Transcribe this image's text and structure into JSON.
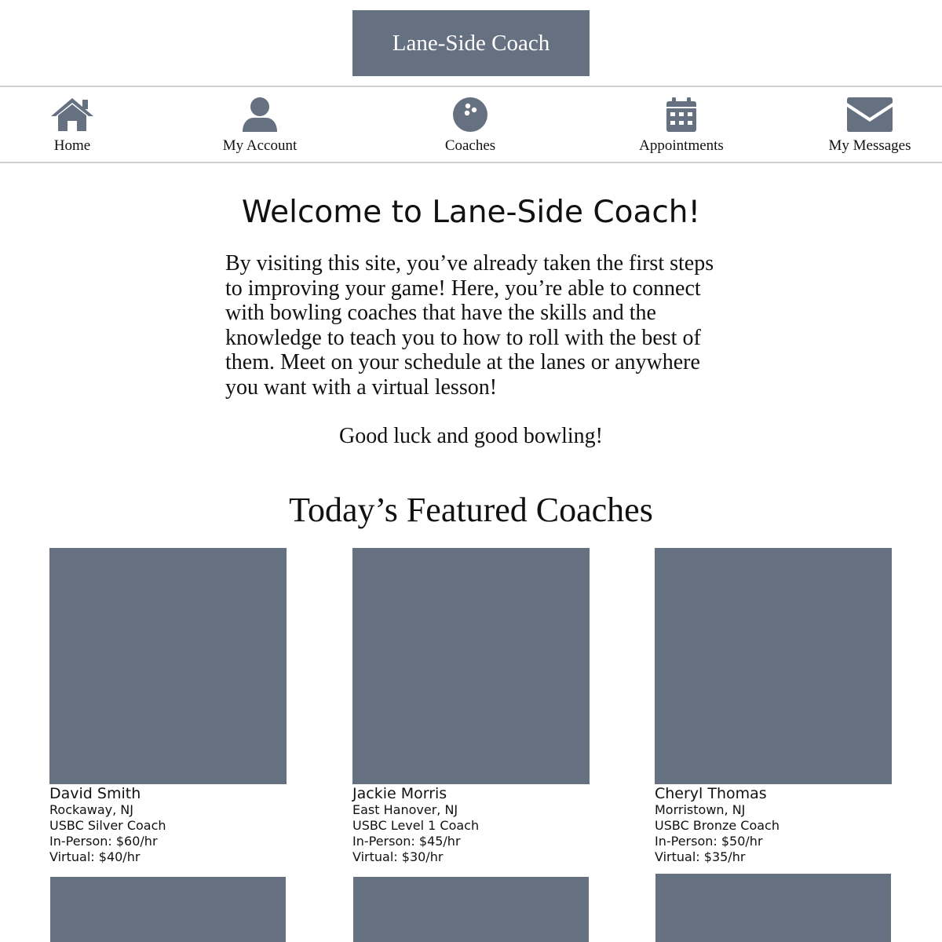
{
  "brand": {
    "name": "Lane-Side Coach",
    "accent_color": "#657081"
  },
  "nav": {
    "items": [
      {
        "label": "Home",
        "icon": "home-icon"
      },
      {
        "label": "My Account",
        "icon": "user-icon"
      },
      {
        "label": "Coaches",
        "icon": "bowling-ball-icon"
      },
      {
        "label": "Appointments",
        "icon": "calendar-icon"
      },
      {
        "label": "My Messages",
        "icon": "envelope-icon"
      }
    ]
  },
  "main": {
    "heading": "Welcome to Lane-Side Coach!",
    "intro": "By visiting this site, you’ve already taken the first steps to improving your game! Here, you’re able to connect with bowling coaches that have the skills and the knowledge to teach you to how to roll with the best of them. Meet on your schedule at the lanes or anywhere you want with a virtual lesson!",
    "closing": "Good luck and good bowling!",
    "featured_heading": "Today’s Featured Coaches"
  },
  "coaches": [
    {
      "name": "David Smith",
      "location": "Rockaway, NJ",
      "certification": "USBC Silver Coach",
      "in_person": "In-Person: $60/hr",
      "virtual": "Virtual: $40/hr"
    },
    {
      "name": "Jackie Morris",
      "location": "East Hanover, NJ",
      "certification": "USBC Level 1 Coach",
      "in_person": "In-Person: $45/hr",
      "virtual": "Virtual: $30/hr"
    },
    {
      "name": "Cheryl Thomas",
      "location": "Morristown, NJ",
      "certification": "USBC Bronze Coach",
      "in_person": "In-Person: $50/hr",
      "virtual": "Virtual: $35/hr"
    }
  ]
}
